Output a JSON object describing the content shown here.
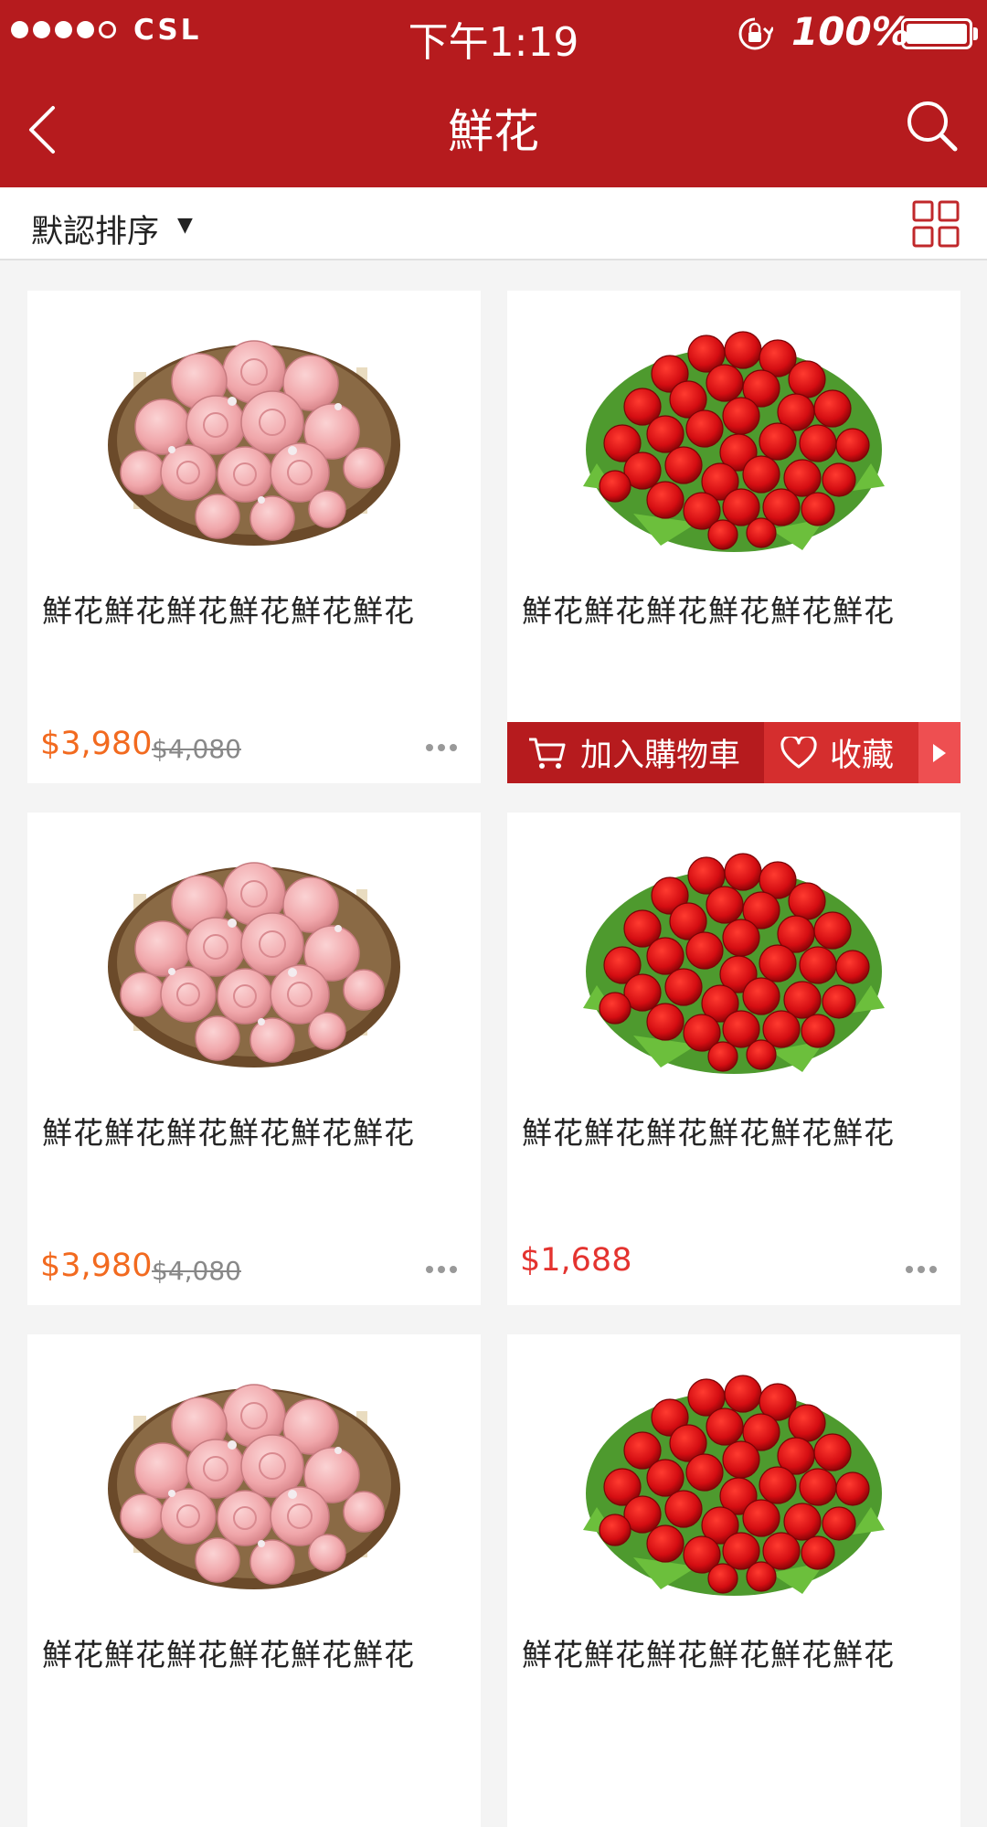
{
  "status_bar": {
    "carrier": "CSL",
    "time": "下午1:19",
    "battery": "100%"
  },
  "nav": {
    "title": "鮮花"
  },
  "sort": {
    "label": "默認排序",
    "arrow": "▼"
  },
  "colors": {
    "brand": "#b61b1e",
    "price_orange": "#f26a1f",
    "price_red": "#e4332f"
  },
  "actions": {
    "add_to_cart": "加入購物車",
    "favorite": "收藏"
  },
  "products": [
    {
      "title": "鮮花鮮花鮮花鮮花鮮花鮮花",
      "price": "$3,980",
      "old_price": "$4,080",
      "image": "pink-rose-bouquet"
    },
    {
      "title": "鮮花鮮花鮮花鮮花鮮花鮮花",
      "price": "",
      "old_price": "",
      "image": "red-rose-bouquet"
    },
    {
      "title": "鮮花鮮花鮮花鮮花鮮花鮮花",
      "price": "$3,980",
      "old_price": "$4,080",
      "image": "pink-rose-bouquet"
    },
    {
      "title": "鮮花鮮花鮮花鮮花鮮花鮮花",
      "price": "$1,688",
      "old_price": "",
      "image": "red-rose-bouquet"
    },
    {
      "title": "鮮花鮮花鮮花鮮花鮮花鮮花",
      "price": "",
      "old_price": "",
      "image": "pink-rose-bouquet"
    },
    {
      "title": "鮮花鮮花鮮花鮮花鮮花鮮花",
      "price": "",
      "old_price": "",
      "image": "red-rose-bouquet"
    }
  ]
}
